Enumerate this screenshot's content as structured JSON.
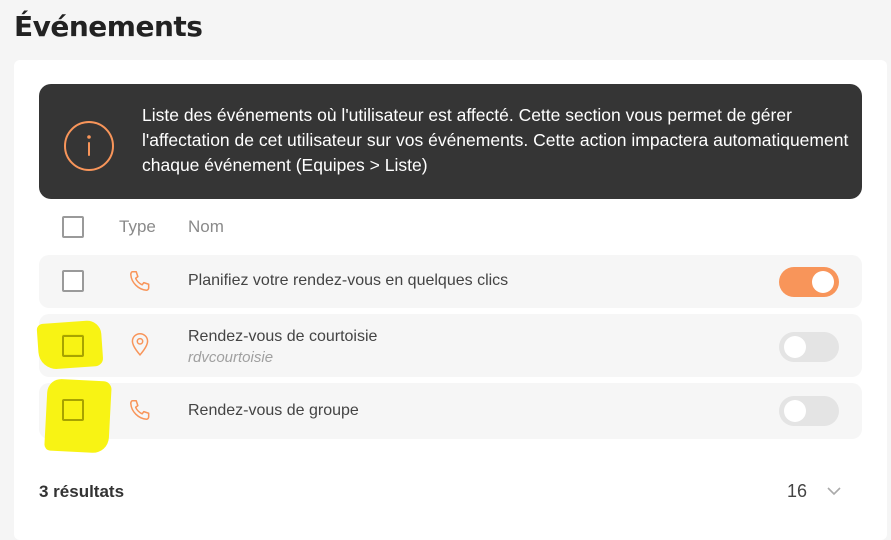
{
  "page": {
    "title": "Événements"
  },
  "info_banner": {
    "icon": "info-icon",
    "text": "Liste des événements où l'utilisateur est affecté. Cette section vous permet de gérer l'affectation de cet utilisateur sur vos événements. Cette action impactera automatiquement chaque événement (Equipes > Liste)"
  },
  "table": {
    "columns": {
      "type": "Type",
      "name": "Nom"
    },
    "rows": [
      {
        "icon": "phone-icon",
        "name": "Planifiez votre rendez-vous en quelques clics",
        "slug": "",
        "enabled": true
      },
      {
        "icon": "location-pin-icon",
        "name": "Rendez-vous de courtoisie",
        "slug": "rdvcourtoisie",
        "enabled": false
      },
      {
        "icon": "phone-icon",
        "name": "Rendez-vous de groupe",
        "slug": "",
        "enabled": false
      }
    ]
  },
  "footer": {
    "results_label": "3 résultats",
    "per_page": "16"
  },
  "colors": {
    "accent": "#f8955a",
    "banner_bg": "#353535",
    "highlight": "#f7f200"
  }
}
